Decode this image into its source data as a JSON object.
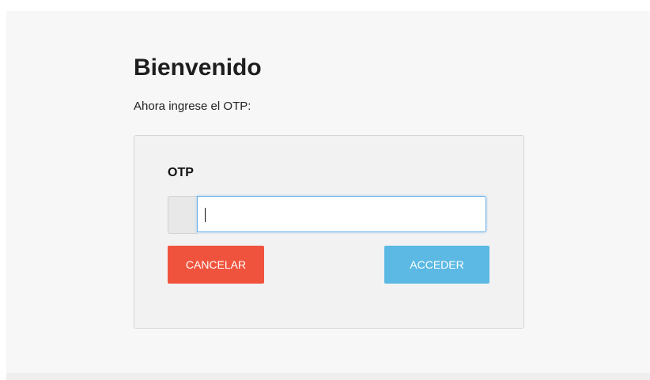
{
  "page": {
    "title": "Bienvenido",
    "subtitle": "Ahora ingrese el OTP:"
  },
  "form": {
    "otp_label": "OTP",
    "otp_value": "",
    "cancel_label": "CANCELAR",
    "access_label": "ACCEDER"
  },
  "colors": {
    "cancel": "#f0533d",
    "access": "#5bb9e3",
    "input_focus_border": "#66afe9"
  }
}
